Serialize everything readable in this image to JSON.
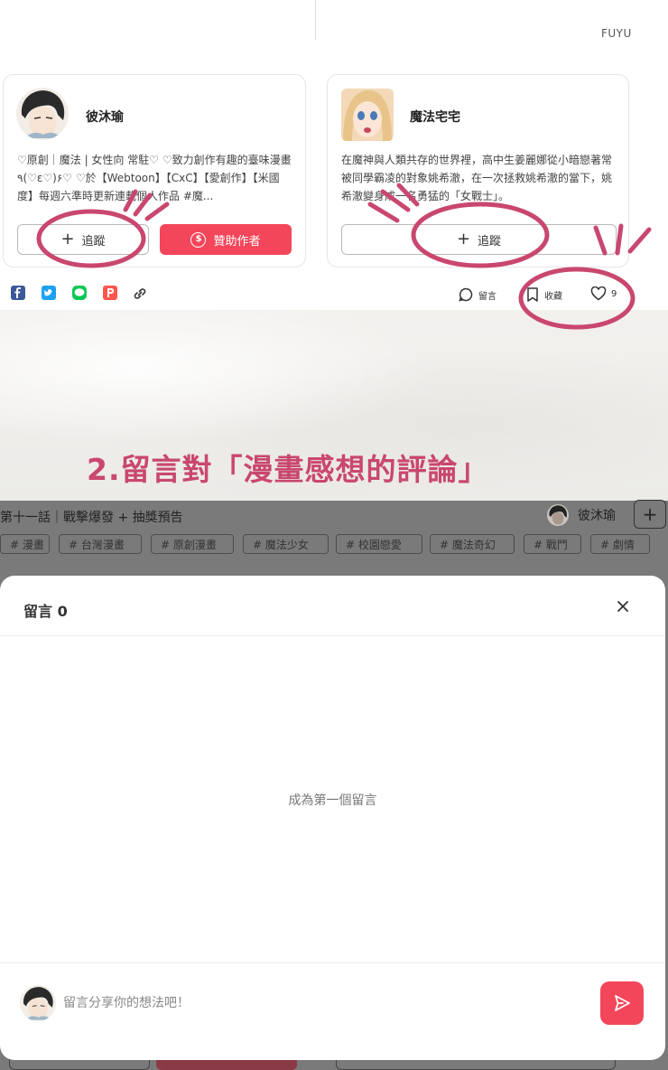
{
  "header": {
    "username": "FUYU"
  },
  "authors": [
    {
      "name": "彼沐瑜",
      "bio": "♡原創｜魔法 | 女性向 常駐♡ ♡致力創作有趣的臺味漫畫٩(♡ε♡)۶♡ ♡於【Webtoon】【CxC】【愛創作】【米國度】每週六準時更新連載個人作品 #魔...",
      "follow_label": "追蹤",
      "sponsor_label": "贊助作者"
    },
    {
      "name": "魔法宅宅",
      "bio": "在魔神與人類共存的世界裡，高中生姜麗娜從小暗戀著常被同學霸凌的對象姚希澈，在一次拯救姚希澈的當下，姚希澈變身成一名勇猛的「女戰士」。",
      "follow_label": "追蹤"
    }
  ],
  "share_bar": {
    "share_icons": [
      "facebook-icon",
      "twitter-icon",
      "line-icon",
      "plurk-icon",
      "link-icon"
    ],
    "comment_label": "留言",
    "bookmark_label": "收藏",
    "like_count": "9"
  },
  "banner": {
    "text": "2.留言對「漫畫感想的評論」"
  },
  "episode": {
    "title": "第十一話｜戰擊爆發 + 抽獎預告",
    "author": "彼沐瑜",
    "tags": [
      "# 漫畫",
      "# 台灣漫畫",
      "# 原創漫畫",
      "# 魔法少女",
      "# 校園戀愛",
      "# 魔法奇幻",
      "# 戰鬥",
      "# 劇情"
    ]
  },
  "comment_modal": {
    "title": "留言 0",
    "empty_text": "成為第一個留言",
    "input_placeholder": "留言分享你的想法吧！"
  },
  "colors": {
    "accent": "#f4465a",
    "annotation": "#c9476f",
    "overlay": "#7a7a7a"
  }
}
